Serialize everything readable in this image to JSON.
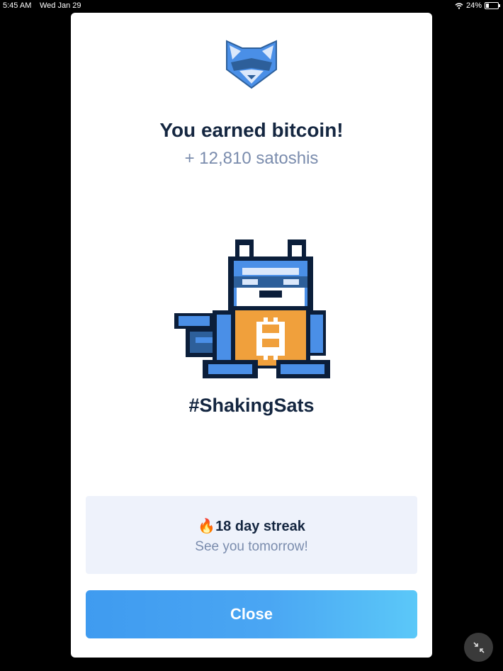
{
  "status_bar": {
    "time": "5:45 AM",
    "date": "Wed Jan 29",
    "battery": "24%",
    "battery_level": 0.24
  },
  "reward": {
    "title": "You earned bitcoin!",
    "amount": "+ 12,810 satoshis",
    "hashtag": "#ShakingSats"
  },
  "streak": {
    "icon": "fire-icon",
    "emoji": "🔥",
    "text": "18 day streak",
    "subtext": "See you tomorrow!"
  },
  "actions": {
    "close_label": "Close"
  },
  "icons": {
    "logo": "raccoon-logo-icon",
    "mascot": "raccoon-mascot-bitcoin-icon",
    "minimize": "collapse-arrows-icon",
    "wifi": "wifi-icon",
    "battery": "battery-icon"
  },
  "colors": {
    "primary_text": "#142640",
    "secondary_text": "#7a8cad",
    "button_start": "#3f9bf0",
    "button_end": "#5bc8f8",
    "streak_bg": "#eef2fb",
    "mascot_blue": "#4a8fe7",
    "mascot_orange": "#f0a03c"
  }
}
